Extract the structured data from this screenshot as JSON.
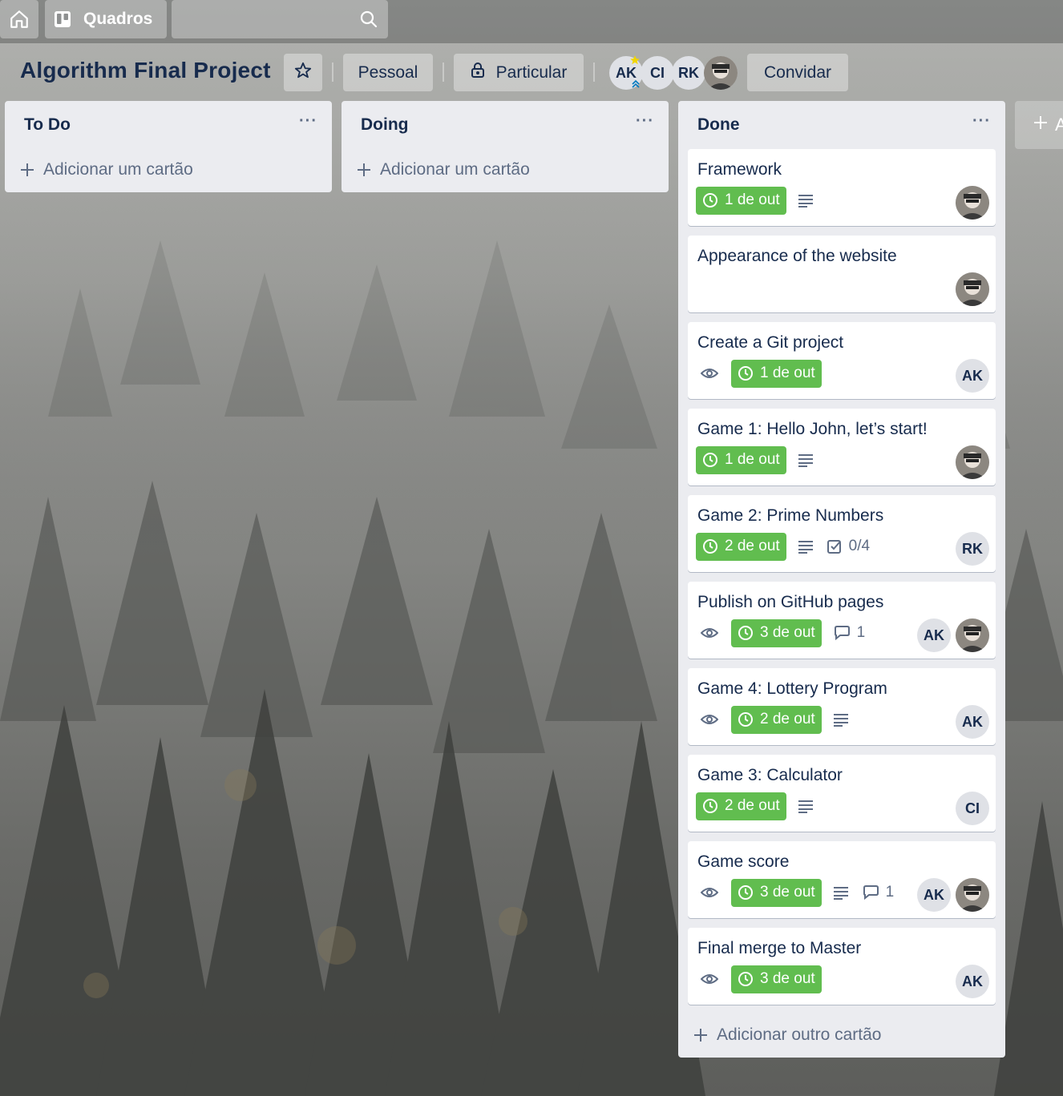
{
  "header": {
    "boards_label": "Quadros",
    "search_placeholder": ""
  },
  "board": {
    "title": "Algorithm Final Project",
    "team_label": "Pessoal",
    "visibility_label": "Particular",
    "invite_label": "Convidar",
    "members": [
      "AK",
      "CI",
      "RK",
      "photo"
    ]
  },
  "lists": [
    {
      "title": "To Do",
      "menu": "···",
      "add_label": "Adicionar um cartão"
    },
    {
      "title": "Doing",
      "menu": "···",
      "add_label": "Adicionar um cartão"
    },
    {
      "title": "Done",
      "menu": "···",
      "add_label": "Adicionar outro cartão",
      "cards": [
        {
          "title": "Framework",
          "watching": false,
          "due": "1 de out",
          "description": true,
          "checklist": "",
          "comments": "",
          "members": [
            "photo"
          ]
        },
        {
          "title": "Appearance of the website",
          "watching": false,
          "due": "",
          "description": false,
          "checklist": "",
          "comments": "",
          "members": [
            "photo"
          ]
        },
        {
          "title": "Create a Git project",
          "watching": true,
          "due": "1 de out",
          "description": false,
          "checklist": "",
          "comments": "",
          "members": [
            "AK"
          ]
        },
        {
          "title": "Game 1: Hello John, let’s start!",
          "watching": false,
          "due": "1 de out",
          "description": true,
          "checklist": "",
          "comments": "",
          "members": [
            "photo"
          ]
        },
        {
          "title": "Game 2: Prime Numbers",
          "watching": false,
          "due": "2 de out",
          "description": true,
          "checklist": "0/4",
          "comments": "",
          "members": [
            "RK"
          ]
        },
        {
          "title": "Publish on GitHub pages",
          "watching": true,
          "due": "3 de out",
          "description": false,
          "checklist": "",
          "comments": "1",
          "members": [
            "AK",
            "photo"
          ]
        },
        {
          "title": "Game 4: Lottery Program",
          "watching": true,
          "due": "2 de out",
          "description": true,
          "checklist": "",
          "comments": "",
          "members": [
            "AK"
          ]
        },
        {
          "title": "Game 3: Calculator",
          "watching": false,
          "due": "2 de out",
          "description": true,
          "checklist": "",
          "comments": "",
          "members": [
            "CI"
          ]
        },
        {
          "title": "Game score",
          "watching": true,
          "due": "3 de out",
          "description": true,
          "checklist": "",
          "comments": "1",
          "members": [
            "AK",
            "photo"
          ]
        },
        {
          "title": "Final merge to Master",
          "watching": true,
          "due": "3 de out",
          "description": false,
          "checklist": "",
          "comments": "",
          "members": [
            "AK"
          ]
        }
      ]
    }
  ],
  "add_list_label": "A",
  "icons": {
    "home": "home-icon",
    "boards": "boards-icon",
    "search": "search-icon",
    "star": "star-icon",
    "lock": "lock-icon",
    "plus": "plus-icon",
    "clock": "clock-icon",
    "eye": "eye-icon",
    "description": "description-icon",
    "checklist": "checklist-icon",
    "comment": "comment-icon"
  },
  "colors": {
    "due_badge": "#61bd4f",
    "list_bg": "#ebecf0",
    "title_text": "#172b4d",
    "muted_text": "#5e6c84"
  }
}
